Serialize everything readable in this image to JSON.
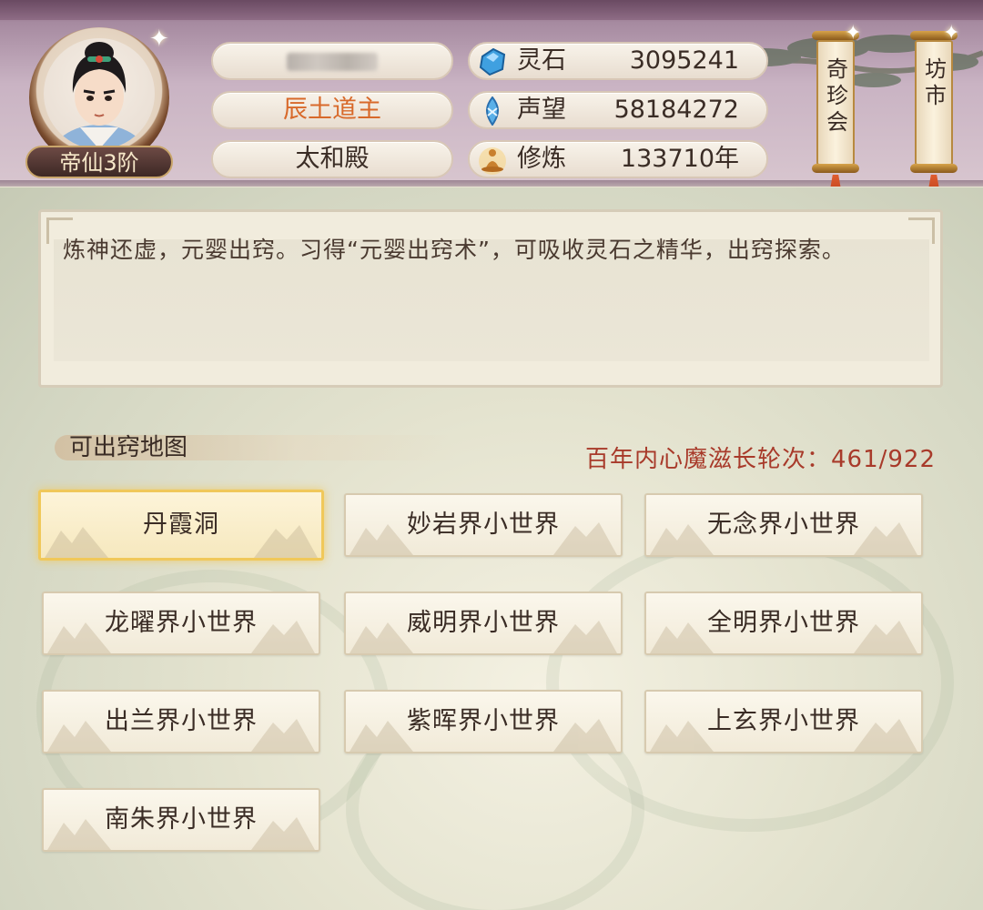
{
  "header": {
    "player_name_obscured": true,
    "rank_label": "帝仙3阶",
    "title": "辰土道主",
    "hall": "太和殿",
    "resources": [
      {
        "icon": "spirit-stone-icon",
        "label": "灵石",
        "value": "3095241"
      },
      {
        "icon": "prestige-icon",
        "label": "声望",
        "value": "58184272"
      },
      {
        "icon": "cultivation-icon",
        "label": "修炼",
        "value": "133710年"
      }
    ],
    "scrolls": [
      {
        "label": "奇珍会"
      },
      {
        "label": "坊市"
      }
    ]
  },
  "description": "炼神还虚，元婴出窍。习得“元婴出窍术”，可吸收灵石之精华，出窍探索。",
  "maps_section": {
    "title": "可出窍地图",
    "counter": "百年内心魔滋长轮次：461/922",
    "maps": [
      {
        "label": "丹霞洞",
        "selected": true
      },
      {
        "label": "妙岩界小世界",
        "selected": false
      },
      {
        "label": "无念界小世界",
        "selected": false
      },
      {
        "label": "龙曜界小世界",
        "selected": false
      },
      {
        "label": "威明界小世界",
        "selected": false
      },
      {
        "label": "全明界小世界",
        "selected": false
      },
      {
        "label": "出兰界小世界",
        "selected": false
      },
      {
        "label": "紫晖界小世界",
        "selected": false
      },
      {
        "label": "上玄界小世界",
        "selected": false
      },
      {
        "label": "南朱界小世界",
        "selected": false
      }
    ]
  },
  "colors": {
    "accent_title": "#d8692a",
    "counter_red": "#a83a2a",
    "selected_border": "#f0c85a"
  }
}
